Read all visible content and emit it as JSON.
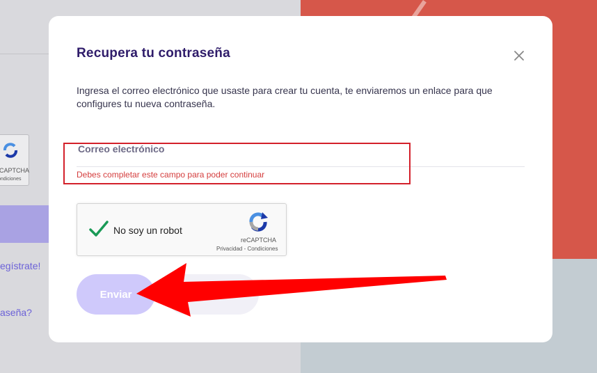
{
  "modal": {
    "title": "Recupera tu contraseña",
    "description": "Ingresa el correo electrónico que usaste para crear tu cuenta, te enviaremos un enlace para que configures tu nueva contraseña.",
    "email_label": "Correo electrónico",
    "email_value": "",
    "email_error": "Debes completar este campo para poder continuar",
    "submit_label": "Enviar",
    "close_icon": "close-icon"
  },
  "recaptcha": {
    "label": "No soy un robot",
    "brand": "reCAPTCHA",
    "terms": "Privacidad - Condiciones",
    "checked": true
  },
  "background": {
    "captcha_brand": "CAPTCHA",
    "captcha_terms": "ondiciones",
    "register_link": "egístrate!",
    "forgot_link": "aseña?"
  },
  "colors": {
    "title": "#2f1c6a",
    "error": "#d43d3d",
    "submit_bg": "#cfc9fb",
    "annotation": "#ff0000",
    "check": "#1a9a56"
  }
}
